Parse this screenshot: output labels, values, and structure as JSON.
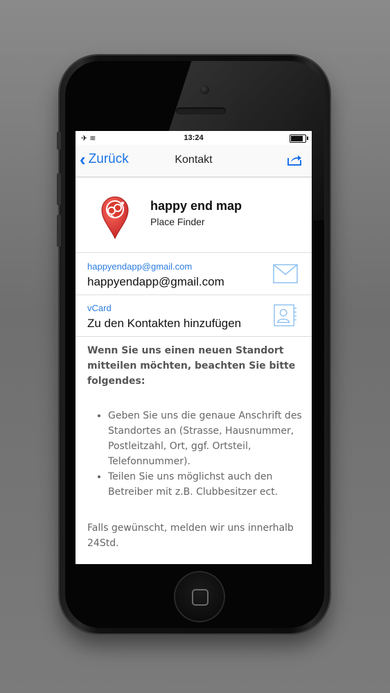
{
  "status_bar": {
    "time": "13:24",
    "icons": "✈ ≋"
  },
  "nav": {
    "back_label": "Zurück",
    "title": "Kontakt",
    "share_icon": "share-icon"
  },
  "app": {
    "name": "happy end map",
    "subtitle": "Place Finder",
    "icon": "map-pin-icon",
    "icon_color": "#e53935"
  },
  "contact_rows": [
    {
      "label": "happyendapp@gmail.com",
      "value": "happyendapp@gmail.com",
      "icon": "mail-icon"
    },
    {
      "label": "vCard",
      "value": "Zu den Kontakten hinzufügen",
      "icon": "contact-card-icon"
    }
  ],
  "info": {
    "heading": "Wenn Sie uns einen neuen Standort mitteilen möchten, beachten Sie bitte folgendes:",
    "bullets": [
      "Geben Sie uns die genaue Anschrift des Standortes an (Strasse, Hausnummer, Postleitzahl, Ort, ggf. Ortsteil, Telefonnummer).",
      "Teilen Sie uns möglichst auch den Betreiber mit z.B. Clubbesitzer ect."
    ],
    "footer": "Falls gewünscht, melden wir uns innerhalb 24Std."
  },
  "colors": {
    "accent": "#2b7de0",
    "text": "#111111"
  }
}
